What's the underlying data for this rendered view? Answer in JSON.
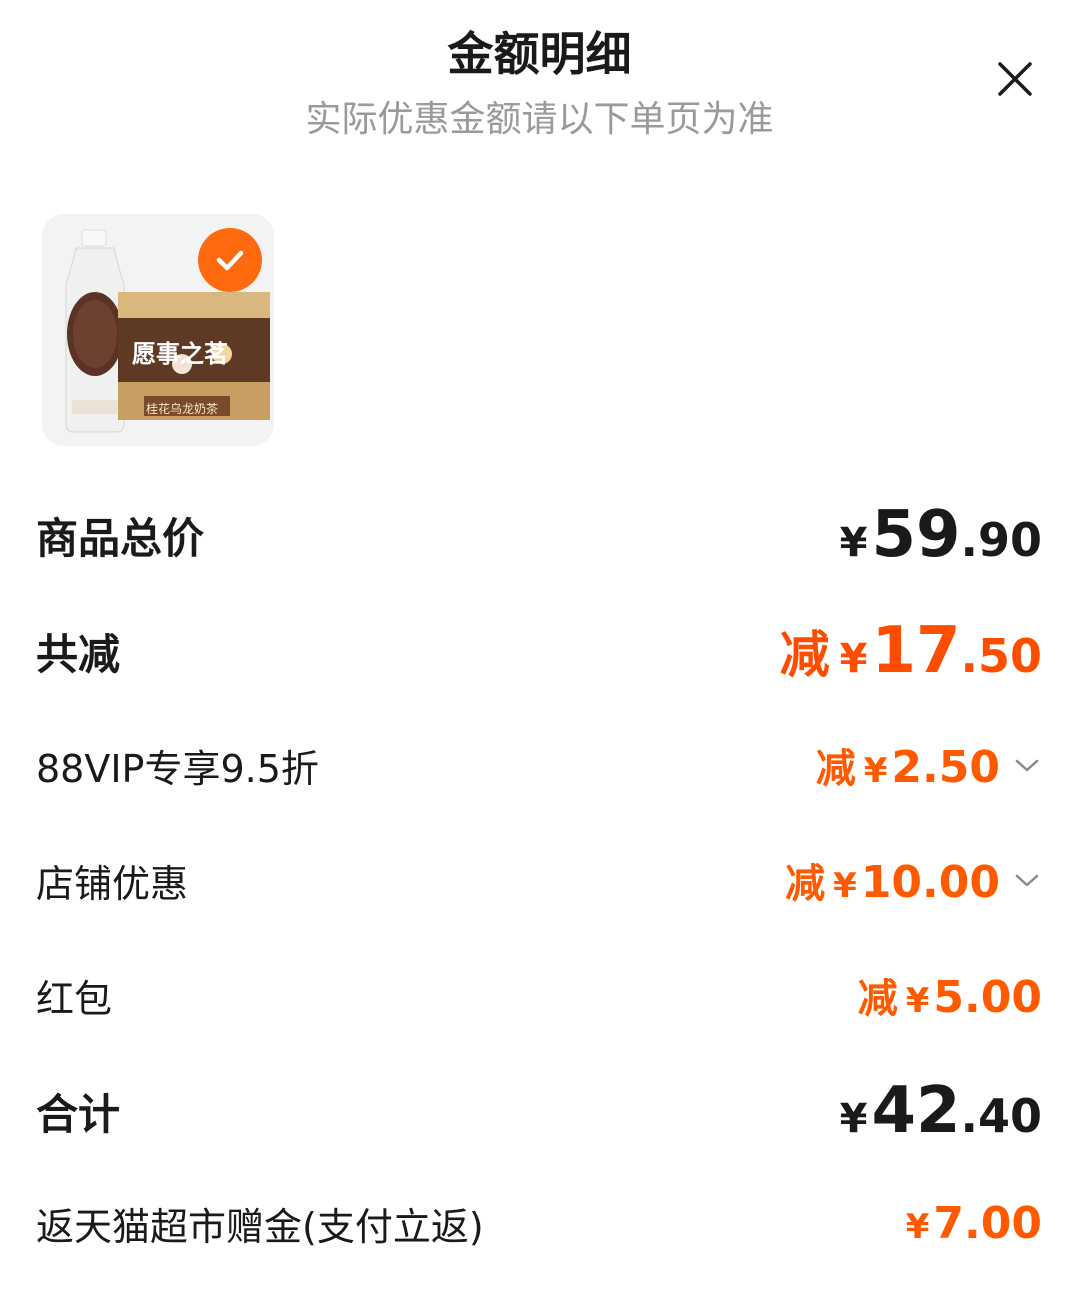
{
  "header": {
    "title": "金额明细",
    "subtitle": "实际优惠金额请以下单页为准"
  },
  "product": {
    "brand_text": "愿事之茗",
    "flavor_text": "桂花乌龙奶茶",
    "selected": true
  },
  "rows": {
    "total_price": {
      "label": "商品总价",
      "yen": "¥",
      "int": "59",
      "dec": ".90"
    },
    "total_discount": {
      "label": "共减",
      "tag": "减",
      "yen": "¥",
      "int": "17",
      "dec": ".50"
    },
    "vip": {
      "label": "88VIP专享9.5折",
      "tag": "减",
      "yen": "¥",
      "int": "2",
      "dec": ".50"
    },
    "shop": {
      "label": "店铺优惠",
      "tag": "减",
      "yen": "¥",
      "int": "10",
      "dec": ".00"
    },
    "hongbao": {
      "label": "红包",
      "tag": "减",
      "yen": "¥",
      "int": "5",
      "dec": ".00"
    },
    "sum": {
      "label": "合计",
      "yen": "¥",
      "int": "42",
      "dec": ".40"
    },
    "cashback": {
      "label": "返天猫超市赠金(支付立返)",
      "yen": "¥",
      "int": "7",
      "dec": ".00"
    }
  },
  "colors": {
    "accent": "#ff5a00",
    "text": "#1a1a1a",
    "subtext": "#9a9a9a"
  }
}
